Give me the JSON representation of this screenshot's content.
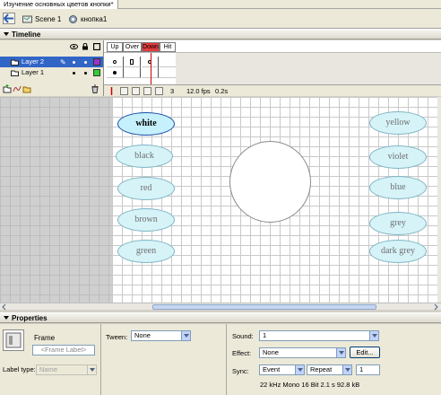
{
  "document": {
    "tab_title": "Изучение основных цветов кнопки*"
  },
  "editbar": {
    "scene_label": "Scene 1",
    "symbol_label": "кнопка1"
  },
  "timeline": {
    "panel_title": "Timeline",
    "frame_labels": [
      "Up",
      "Over",
      "Down",
      "Hit"
    ],
    "layers": [
      {
        "name": "Layer 2",
        "selected": true,
        "color": "#9933cc"
      },
      {
        "name": "Layer 1",
        "selected": false,
        "color": "#33cc33"
      }
    ],
    "current_frame": "3",
    "frame_rate": "12.0 fps",
    "elapsed": "0.2s"
  },
  "stage": {
    "buttons_left": [
      "white",
      "black",
      "red",
      "brown",
      "green"
    ],
    "buttons_right": [
      "yellow",
      "violet",
      "blue",
      "grey",
      "dark grey"
    ],
    "selected_button": "white",
    "oval_fill": "#d6f3f8",
    "oval_border": "#7fb5c3"
  },
  "properties": {
    "panel_title": "Properties",
    "symbol_type": "Frame",
    "frame_label_placeholder": "<Frame Label>",
    "label_type_label": "Label type:",
    "label_type_value": "Name",
    "tween_label": "Tween:",
    "tween_value": "None",
    "sound_label": "Sound:",
    "sound_value": "1",
    "effect_label": "Effect:",
    "effect_value": "None",
    "edit_button": "Edit...",
    "sync_label": "Sync:",
    "sync_value": "Event",
    "repeat_value": "Repeat",
    "repeat_count": "1",
    "sound_info": "22 kHz Mono 16 Bit 2.1 s 92.8 kB"
  }
}
